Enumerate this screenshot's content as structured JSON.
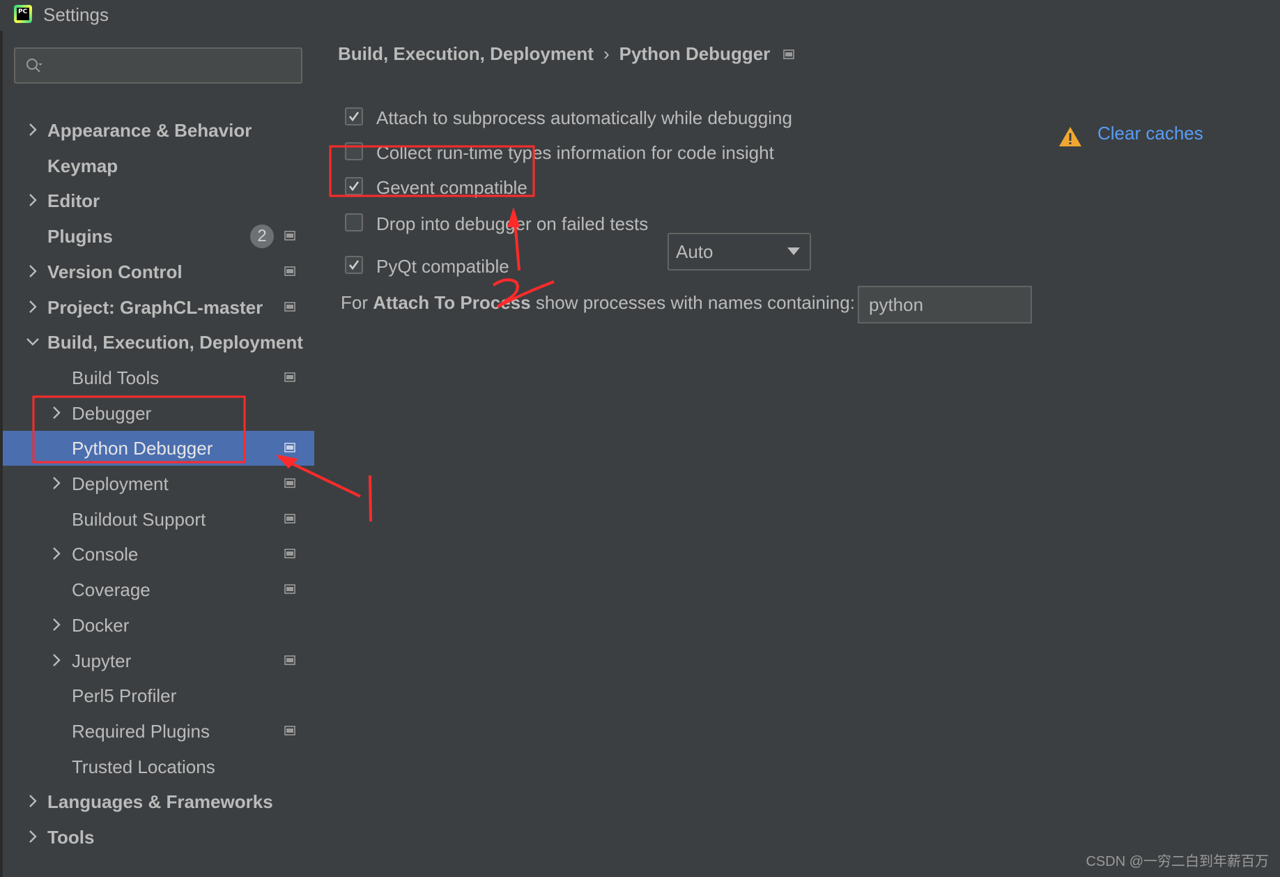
{
  "window": {
    "title": "Settings",
    "app_icon": "pycharm-logo",
    "app_icon_text": "PC"
  },
  "search": {
    "placeholder": "",
    "icon": "search-icon"
  },
  "sidebar": {
    "items": [
      {
        "label": "Appearance & Behavior",
        "bold": true,
        "chevron": "right"
      },
      {
        "label": "Keymap",
        "bold": true
      },
      {
        "label": "Editor",
        "bold": true,
        "chevron": "right"
      },
      {
        "label": "Plugins",
        "bold": true,
        "badge": "2",
        "project_icon": true
      },
      {
        "label": "Version Control",
        "bold": true,
        "chevron": "right",
        "project_icon": true
      },
      {
        "label": "Project: GraphCL-master",
        "bold": true,
        "chevron": "right",
        "project_icon": true
      },
      {
        "label": "Build, Execution, Deployment",
        "bold": true,
        "chevron": "down"
      },
      {
        "label": "Build Tools",
        "project_icon": true
      },
      {
        "label": "Debugger",
        "chevron": "right"
      },
      {
        "label": "Python Debugger",
        "selected": true,
        "project_icon": true
      },
      {
        "label": "Deployment",
        "chevron": "right",
        "project_icon": true
      },
      {
        "label": "Buildout Support",
        "project_icon": true
      },
      {
        "label": "Console",
        "chevron": "right",
        "project_icon": true
      },
      {
        "label": "Coverage",
        "project_icon": true
      },
      {
        "label": "Docker",
        "chevron": "right"
      },
      {
        "label": "Jupyter",
        "chevron": "right",
        "project_icon": true
      },
      {
        "label": "Perl5 Profiler"
      },
      {
        "label": "Required Plugins",
        "project_icon": true
      },
      {
        "label": "Trusted Locations"
      },
      {
        "label": "Languages & Frameworks",
        "bold": true,
        "chevron": "right"
      },
      {
        "label": "Tools",
        "bold": true,
        "chevron": "right"
      }
    ]
  },
  "breadcrumb": {
    "parent": "Build, Execution, Deployment",
    "separator": "›",
    "current": "Python Debugger"
  },
  "options": [
    {
      "label": "Attach to subprocess automatically while debugging",
      "checked": true
    },
    {
      "label": "Collect run-time types information for code insight",
      "checked": false
    },
    {
      "label": "Gevent compatible",
      "checked": true
    },
    {
      "label": "Drop into debugger on failed tests",
      "checked": false
    },
    {
      "label": "PyQt compatible",
      "checked": true
    }
  ],
  "clear_caches": {
    "label": "Clear caches",
    "icon": "warning-icon",
    "icon_color": "#f0a732"
  },
  "pyqt_select": {
    "value": "Auto"
  },
  "attach": {
    "prefix": "For ",
    "bold": "Attach To Process",
    "suffix": " show processes with names containing:",
    "value": "python"
  },
  "annotations": {
    "color": "#ff2b2b",
    "marks": [
      "1",
      "2"
    ]
  },
  "watermark": "CSDN @一穷二白到年薪百万",
  "colors": {
    "background": "#3c3f41",
    "selection": "#4b6eaf",
    "link": "#589df6",
    "text": "#bbbbbb"
  }
}
